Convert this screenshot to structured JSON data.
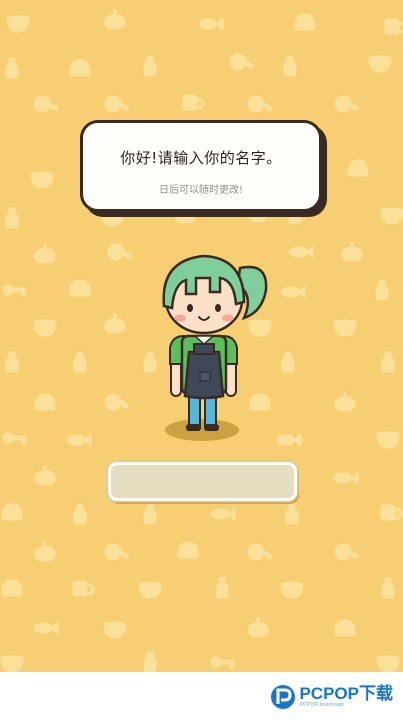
{
  "dialog": {
    "title": "你好!请输入你的名字。",
    "subtitle": "日后可以随时更改!"
  },
  "name_input": {
    "value": "",
    "placeholder": ""
  },
  "watermark": {
    "brand": "PCPOP下载",
    "tagline": "PCPOP.download"
  },
  "colors": {
    "background": "#f6cf73",
    "pattern": "#fbe09a",
    "dialog_border": "#3a2a24",
    "input_fill": "#e5ddc0",
    "watermark_blue": "#1b76c9"
  },
  "background_pattern_icons": [
    "bread-icon",
    "bottle-icon",
    "pan-icon",
    "bowl-icon",
    "fish-icon",
    "fork-icon",
    "key-icon",
    "apple-icon",
    "carrot-icon",
    "cup-icon"
  ]
}
